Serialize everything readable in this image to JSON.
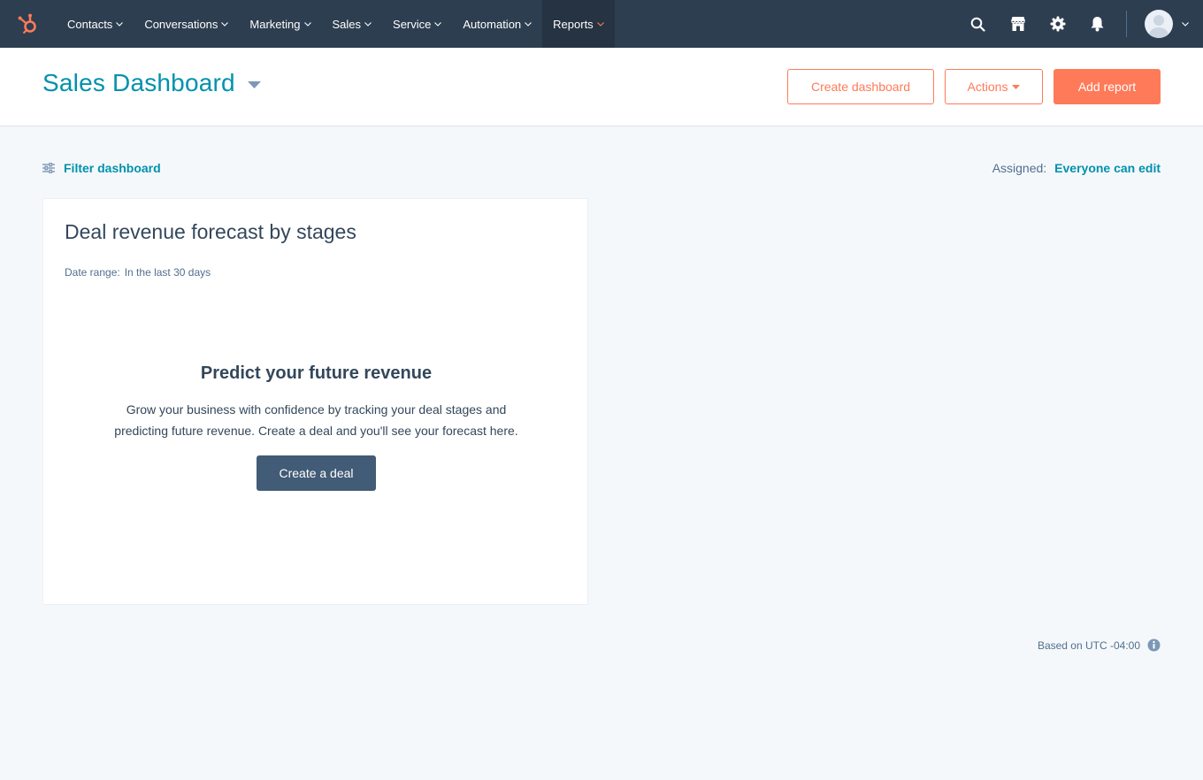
{
  "nav": {
    "items": [
      {
        "label": "Contacts"
      },
      {
        "label": "Conversations"
      },
      {
        "label": "Marketing"
      },
      {
        "label": "Sales"
      },
      {
        "label": "Service"
      },
      {
        "label": "Automation"
      },
      {
        "label": "Reports"
      }
    ],
    "active_item": "Reports",
    "right_icons": [
      "search-icon",
      "marketplace-icon",
      "gear-icon",
      "bell-icon"
    ]
  },
  "header": {
    "title": "Sales Dashboard",
    "create_dashboard_label": "Create dashboard",
    "actions_label": "Actions",
    "add_report_label": "Add report"
  },
  "filter": {
    "label": "Filter dashboard",
    "assigned_label": "Assigned:",
    "assigned_value": "Everyone can edit"
  },
  "card": {
    "title": "Deal revenue forecast by stages",
    "date_range_label": "Date range:",
    "date_range_value": "In the last 30 days",
    "empty_title": "Predict your future revenue",
    "empty_description": "Grow your business with confidence by tracking your deal stages and predicting future revenue. Create a deal and you'll see your forecast here.",
    "cta_label": "Create a deal"
  },
  "footer": {
    "timezone_note": "Based on UTC -04:00"
  },
  "colors": {
    "nav_bg": "#2d3e50",
    "accent_teal": "#0091ae",
    "accent_orange": "#ff7a59",
    "dark_button": "#425b76",
    "page_bg": "#f5f8fa"
  }
}
